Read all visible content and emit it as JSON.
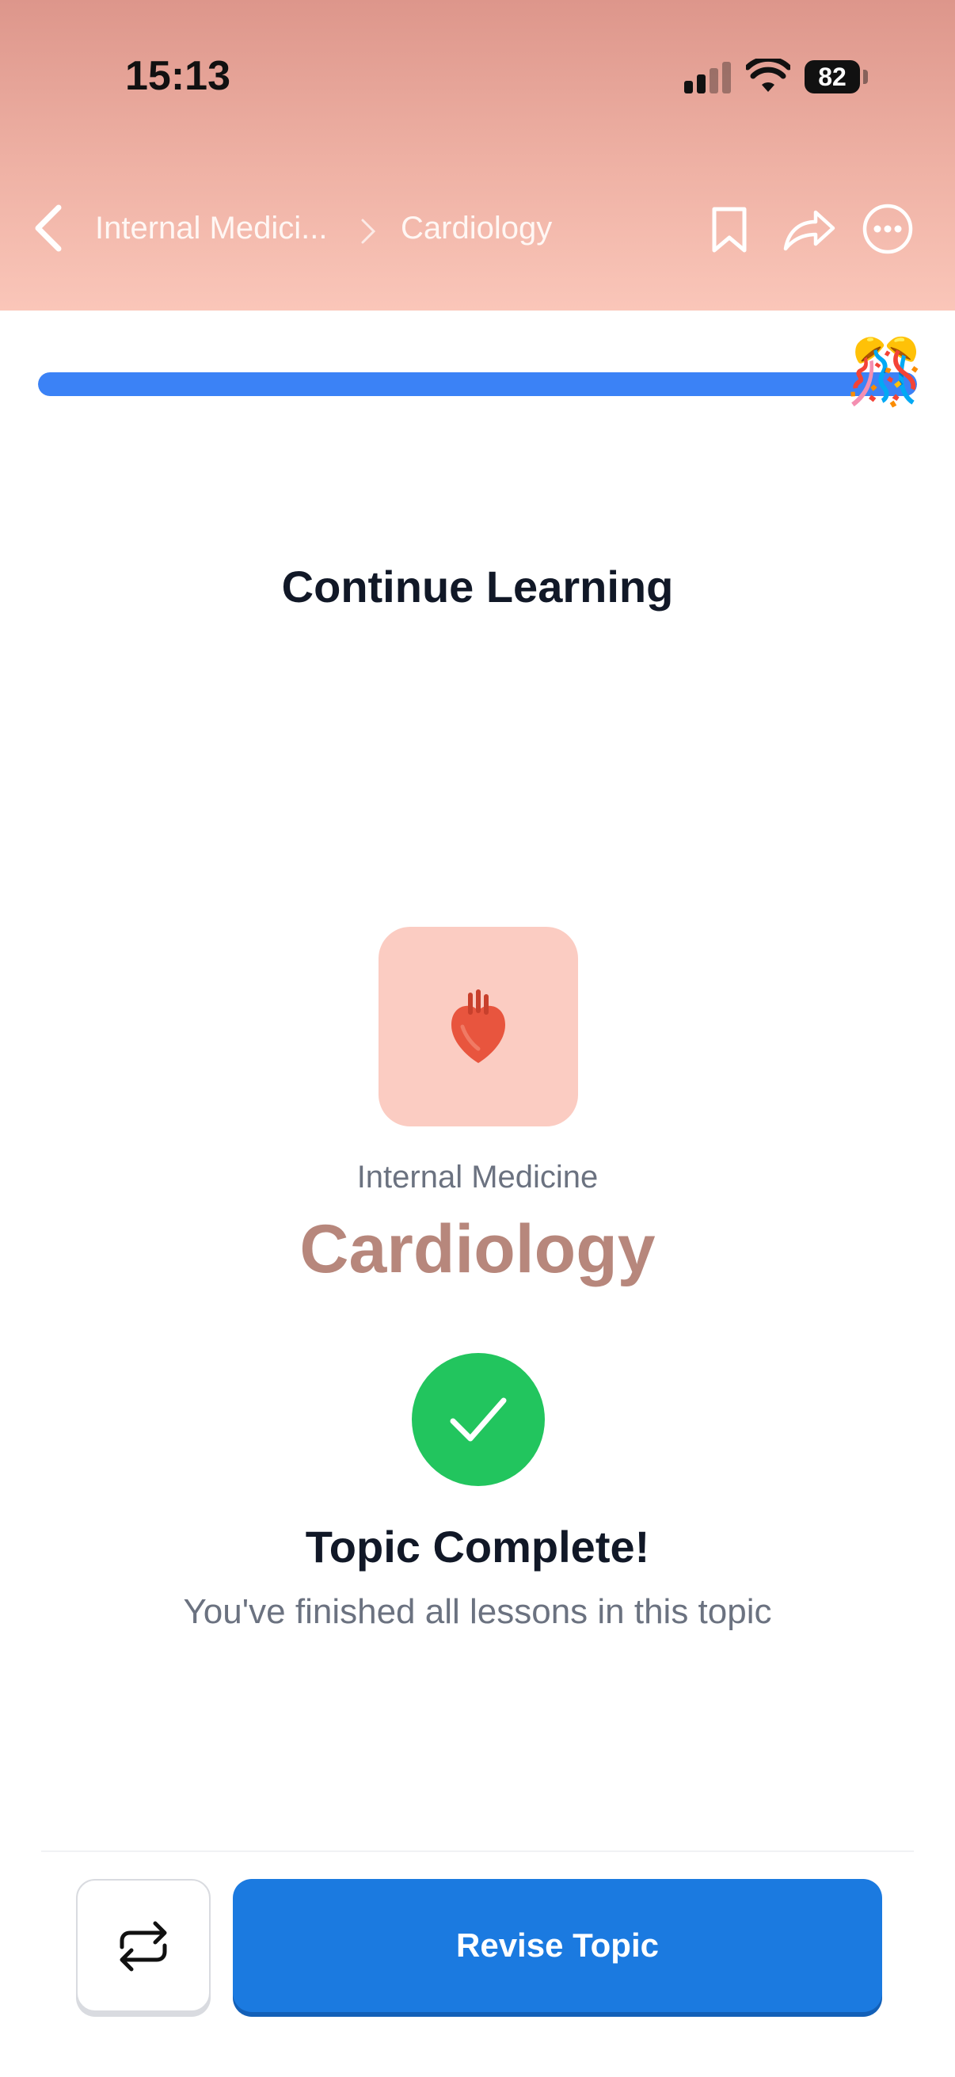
{
  "status_bar": {
    "time": "15:13",
    "battery": "82",
    "signal_icon": "cellular-signal-icon",
    "wifi_icon": "wifi-icon"
  },
  "header": {
    "breadcrumb": [
      "Internal Medici...",
      "Cardiology"
    ],
    "icons": [
      "back-chevron-icon",
      "bookmark-icon",
      "share-icon",
      "more-icon"
    ]
  },
  "progress": {
    "fraction": 1.0,
    "icon": "party-popper-icon"
  },
  "main": {
    "title": "Continue Learning",
    "topic_icon": "anatomical-heart-icon",
    "subject": "Internal Medicine",
    "topic": "Cardiology",
    "status_icon": "checkmark-icon",
    "complete_title": "Topic Complete!",
    "complete_subtitle": "You've finished all lessons in this topic"
  },
  "footer": {
    "repeat_icon": "repeat-icon",
    "primary_button": "Revise Topic"
  },
  "colors": {
    "header_gradient": [
      "#dd968b",
      "#fac6b9"
    ],
    "progress": "#3b82f6",
    "topic_accent": "#b7877c",
    "success": "#22c55e",
    "primary": "#1b7ae0"
  }
}
